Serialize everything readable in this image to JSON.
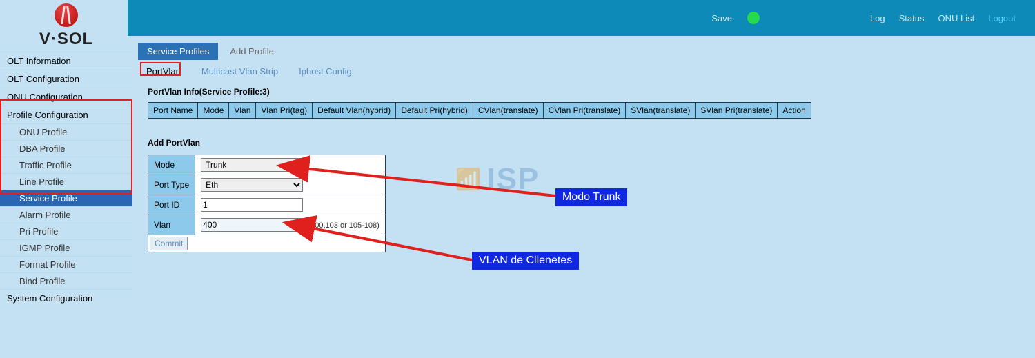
{
  "brand": "V·SOL",
  "topbar": {
    "save": "Save",
    "log": "Log",
    "status": "Status",
    "onu_list": "ONU List",
    "logout": "Logout"
  },
  "sidebar": {
    "cats": [
      "OLT Information",
      "OLT Configuration",
      "ONU Configuration",
      "Profile Configuration",
      "System Configuration"
    ],
    "profile_subs": [
      "ONU Profile",
      "DBA Profile",
      "Traffic Profile",
      "Line Profile",
      "Service Profile",
      "Alarm Profile",
      "Pri Profile",
      "IGMP Profile",
      "Format Profile",
      "Bind Profile"
    ]
  },
  "tabs": {
    "main": [
      "Service Profiles",
      "Add Profile"
    ],
    "sub": [
      "PortVlan",
      "Multicast Vlan Strip",
      "Iphost Config"
    ]
  },
  "portvlan_info": {
    "title": "PortVlan Info(Service Profile:3)",
    "cols": [
      "Port Name",
      "Mode",
      "Vlan",
      "Vlan Pri(tag)",
      "Default Vlan(hybrid)",
      "Default Pri(hybrid)",
      "CVlan(translate)",
      "CVlan Pri(translate)",
      "SVlan(translate)",
      "SVlan Pri(translate)",
      "Action"
    ]
  },
  "add_form": {
    "title": "Add PortVlan",
    "mode_label": "Mode",
    "mode_value": "Trunk",
    "porttype_label": "Port Type",
    "porttype_value": "Eth",
    "portid_label": "Port ID",
    "portid_value": "1",
    "vlan_label": "Vlan",
    "vlan_value": "400",
    "vlan_hint": "(100,103 or 105-108)",
    "commit": "Commit"
  },
  "callouts": {
    "modo": "Modo Trunk",
    "vlan_clientes": "VLAN de Clienetes"
  },
  "watermark": "ISP"
}
